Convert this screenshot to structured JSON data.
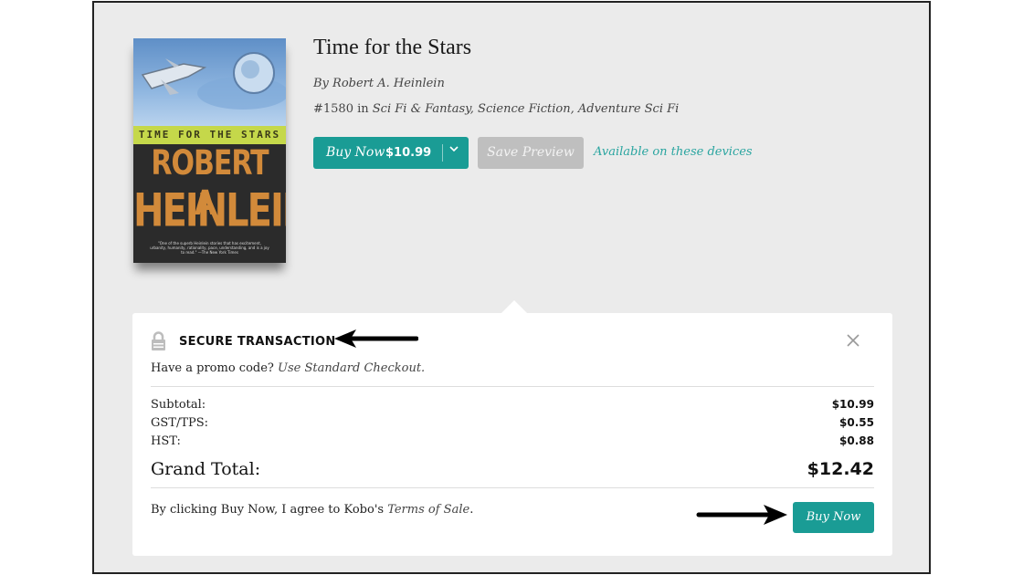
{
  "book": {
    "title": "Time for the Stars",
    "author_line": "By Robert A. Heinlein",
    "rank_prefix": "#1580 in ",
    "categories": "Sci Fi & Fantasy, Science Fiction, Adventure Sci Fi",
    "cover": {
      "band_text": "TIME FOR THE STARS",
      "author_line1": "ROBERT A.",
      "author_line2": "HEINLEIN",
      "quote": "\"One of the superb Heinlein stories that has excitement, urbanity, humanity, rationality, pace, understanding, and is a joy to read.\" —The New York Times"
    }
  },
  "actions": {
    "buy_label": "Buy Now",
    "buy_price": "$10.99",
    "dropdown_icon": "chevron-down-icon",
    "save_preview_label": "Save Preview",
    "devices_link": "Available on these devices"
  },
  "checkout": {
    "secure_title": "SECURE TRANSACTION",
    "lock_icon": "lock-icon",
    "close_icon": "close-icon",
    "promo_text": "Have a promo code? ",
    "promo_link": "Use Standard Checkout.",
    "lines": [
      {
        "label": "Subtotal:",
        "value": "$10.99"
      },
      {
        "label": "GST/TPS:",
        "value": "$0.55"
      },
      {
        "label": "HST:",
        "value": "$0.88"
      }
    ],
    "grand_total_label": "Grand Total:",
    "grand_total_value": "$12.42",
    "terms_prefix": "By clicking Buy Now, I agree to Kobo's ",
    "terms_link": "Terms of Sale",
    "terms_suffix": ".",
    "buy_now_label": "Buy Now"
  },
  "colors": {
    "accent": "#1a9c95",
    "link": "#2aa5a0",
    "disabled": "#bfbfbf",
    "background": "#ebebeb"
  }
}
